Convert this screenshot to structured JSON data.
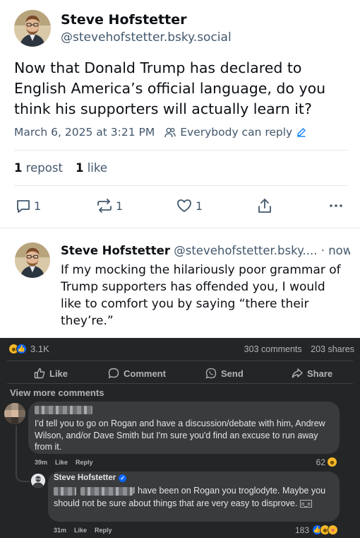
{
  "bluesky": {
    "post": {
      "author_name": "Steve Hofstetter",
      "author_handle": "@stevehofstetter.bsky.social",
      "text": "Now that Donald Trump has declared to English America’s official language, do you think his supporters will actually learn it?",
      "timestamp": "March 6, 2025 at 3:21 PM",
      "reply_setting": "Everybody can reply",
      "reposts_count": "1",
      "reposts_label": "repost",
      "likes_count": "1",
      "likes_label": "like",
      "action_counts": {
        "reply": "1",
        "repost": "1",
        "like": "1"
      }
    },
    "reply": {
      "author_name": "Steve Hofstetter",
      "author_handle": "@stevehofstetter.bsky....",
      "time": "· now",
      "text": "If my mocking the hilariously poor grammar of Trump supporters has offended you, I would like to comfort you by saying “there their they’re.”"
    }
  },
  "facebook": {
    "reactions_total": "3.1K",
    "comments_count": "303 comments",
    "shares_count": "203 shares",
    "actions": {
      "like": "Like",
      "comment": "Comment",
      "send": "Send",
      "share": "Share"
    },
    "view_more": "View more comments",
    "comments": [
      {
        "text": "I'd tell you to go on Rogan and have a discussion/debate with him, Andrew Wilson, and/or Dave Smith but I'm sure you'd find an excuse to run away from it.",
        "time": "39m",
        "like_label": "Like",
        "reply_label": "Reply",
        "reaction_count": "62"
      },
      {
        "author": "Steve Hofstetter",
        "text": "I have been on Rogan you troglodyte. Maybe you should not be sure about things that are very easy to disprove.",
        "emoji_text": "ಠ_ಠ",
        "time": "31m",
        "like_label": "Like",
        "reply_label": "Reply",
        "reaction_count": "183"
      }
    ]
  },
  "colors": {
    "bluesky_text": "#0b0f14",
    "bluesky_muted": "#42576c",
    "bluesky_accent": "#1083fe",
    "fb_bg": "#242526",
    "fb_bubble": "#3a3b3c",
    "fb_text": "#e4e6eb",
    "fb_muted": "#b0b3b8",
    "fb_like_blue": "#0866ff",
    "fb_haha_yellow": "#f7b928"
  }
}
